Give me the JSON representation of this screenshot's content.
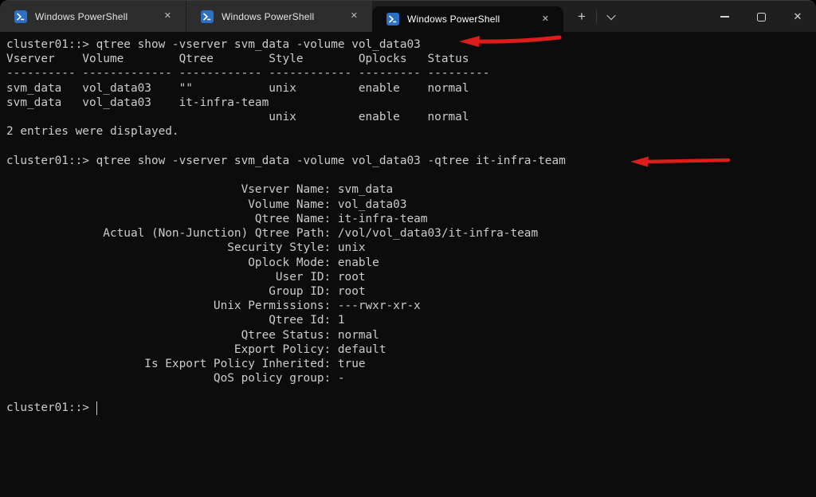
{
  "window": {
    "tabs": [
      {
        "title": "Windows PowerShell",
        "active": false
      },
      {
        "title": "Windows PowerShell",
        "active": false
      },
      {
        "title": "Windows PowerShell",
        "active": true
      }
    ],
    "icons": {
      "powershell": "blue rounded square with white >_ prompt",
      "tab_close": "✕",
      "new_tab": "+",
      "dropdown": "chevron-down",
      "minimize": "thin horizontal bar",
      "maximize": "outlined square",
      "window_close": "✕"
    }
  },
  "terminal": {
    "lines_before_details": [
      "cluster01::> qtree show -vserver svm_data -volume vol_data03",
      "Vserver    Volume        Qtree        Style        Oplocks   Status",
      "---------- ------------- ------------ ------------ --------- ---------",
      "svm_data   vol_data03    \"\"           unix         enable    normal",
      "svm_data   vol_data03    it-infra-team",
      "                                      unix         enable    normal",
      "2 entries were displayed.",
      "",
      "cluster01::> qtree show -vserver svm_data -volume vol_data03 -qtree it-infra-team",
      ""
    ],
    "details": {
      "colon_column": 46,
      "rows": [
        {
          "label": "Vserver Name",
          "value": "svm_data"
        },
        {
          "label": "Volume Name",
          "value": "vol_data03"
        },
        {
          "label": "Qtree Name",
          "value": "it-infra-team"
        },
        {
          "label": "Actual (Non-Junction) Qtree Path",
          "value": "/vol/vol_data03/it-infra-team"
        },
        {
          "label": "Security Style",
          "value": "unix"
        },
        {
          "label": "Oplock Mode",
          "value": "enable"
        },
        {
          "label": "User ID",
          "value": "root"
        },
        {
          "label": "Group ID",
          "value": "root"
        },
        {
          "label": "Unix Permissions",
          "value": "---rwxr-xr-x"
        },
        {
          "label": "Qtree Id",
          "value": "1"
        },
        {
          "label": "Qtree Status",
          "value": "normal"
        },
        {
          "label": "Export Policy",
          "value": "default"
        },
        {
          "label": "Is Export Policy Inherited",
          "value": "true"
        },
        {
          "label": "QoS policy group",
          "value": "-"
        }
      ]
    },
    "lines_after_details": [
      ""
    ],
    "prompt": "cluster01::> "
  },
  "annotations": {
    "arrow_color": "#de1c1c",
    "arrows": [
      {
        "points_at": "first qtree show command",
        "direction": "left"
      },
      {
        "points_at": "second qtree show command",
        "direction": "left"
      }
    ]
  },
  "colors": {
    "terminal_bg": "#0c0c0c",
    "terminal_fg": "#cccccc",
    "titlebar_bg": "#1f1f1f",
    "tab_inactive": "#2d2d2d",
    "tab_active": "#0c0c0c",
    "arrow_red": "#de1c1c",
    "ps_blue": "#2b70c4"
  }
}
